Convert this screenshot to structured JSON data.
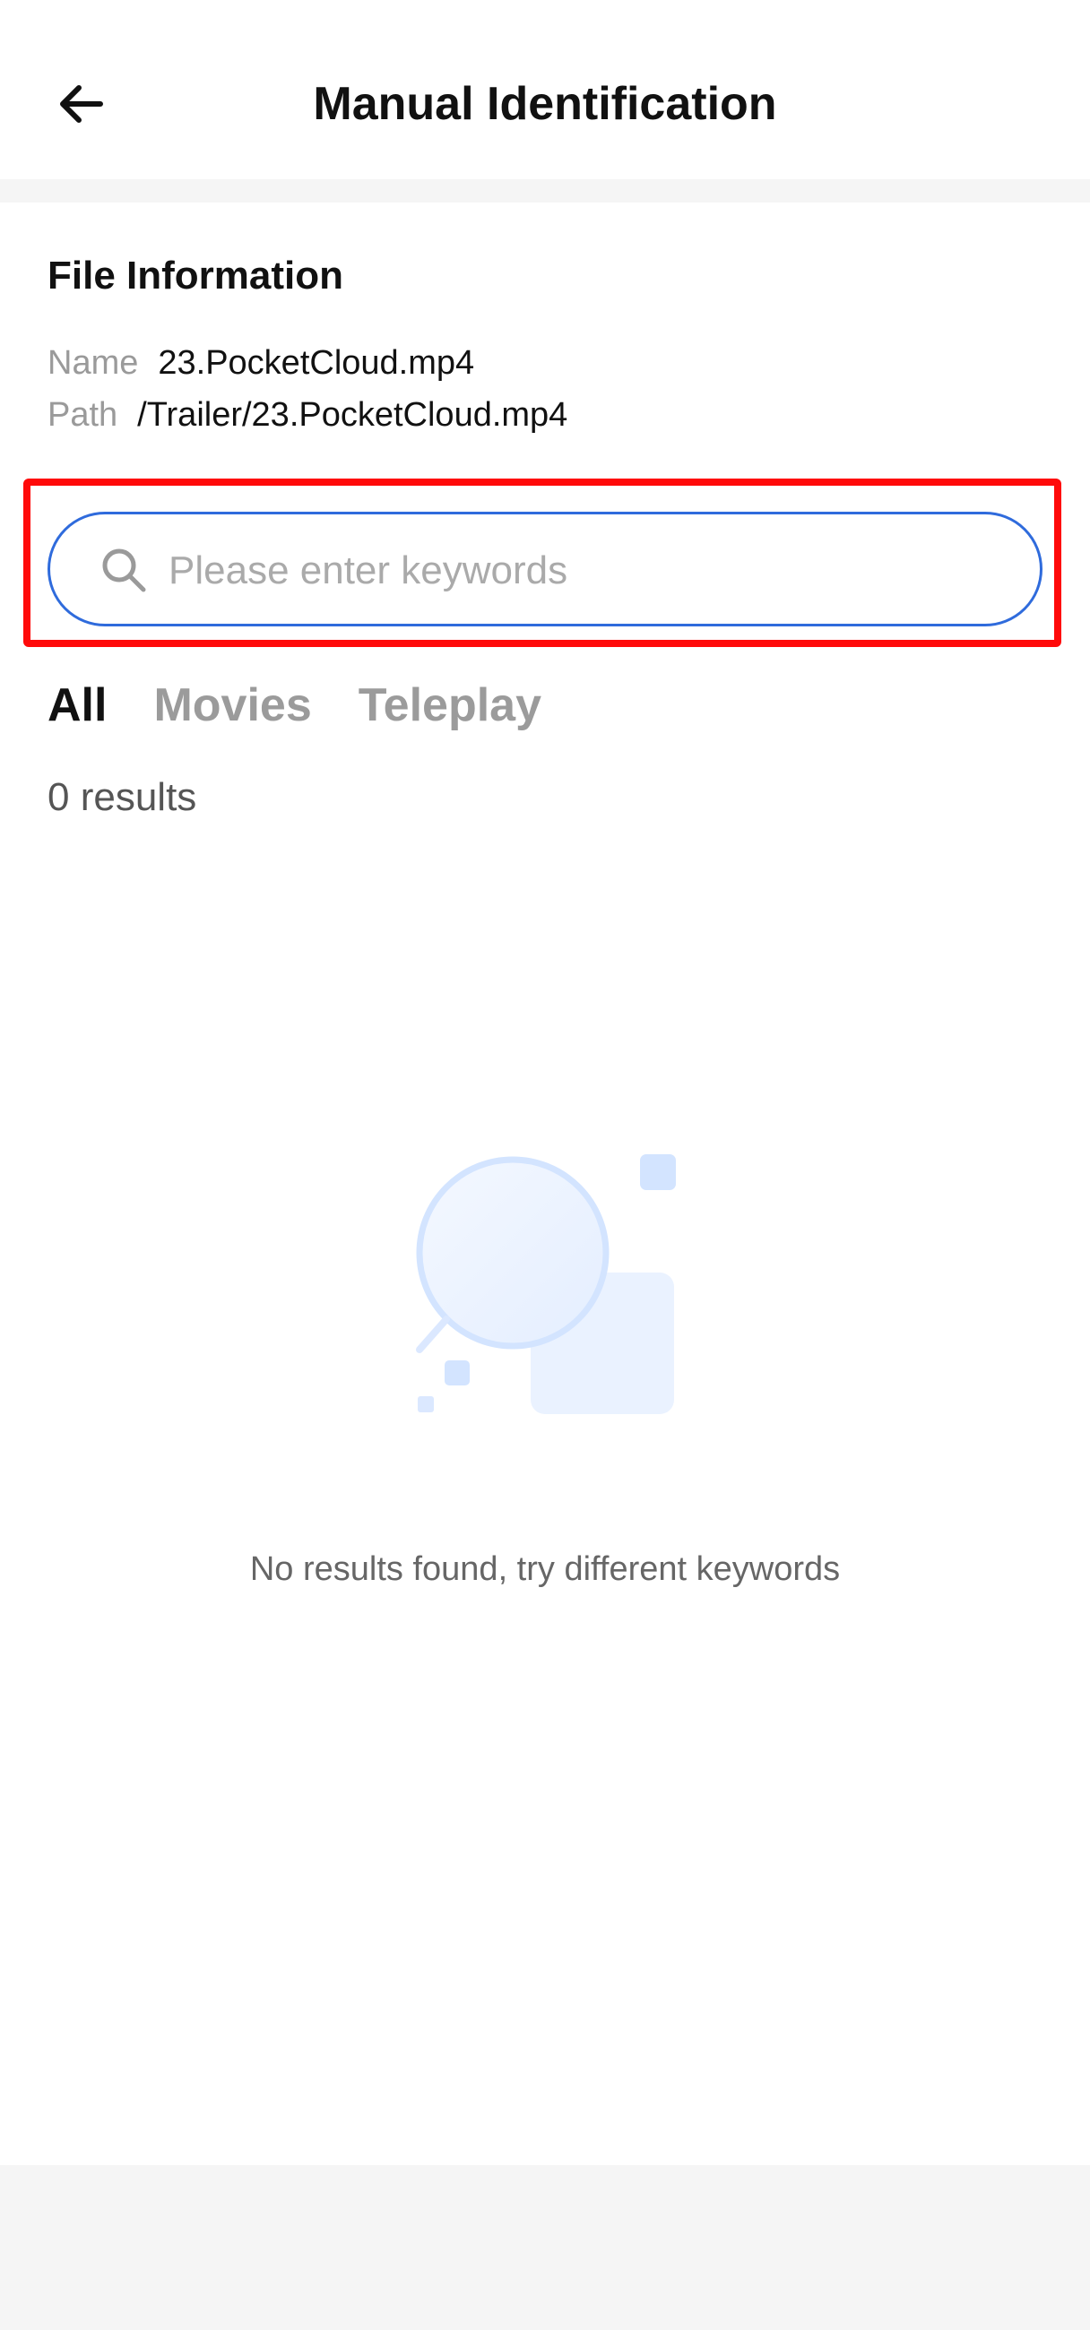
{
  "header": {
    "title": "Manual Identification",
    "back_icon": "arrow-left-icon"
  },
  "file_info": {
    "section_title": "File Information",
    "name_label": "Name",
    "name_value": "23.PocketCloud.mp4",
    "path_label": "Path",
    "path_value": "/Trailer/23.PocketCloud.mp4"
  },
  "search": {
    "icon": "search-icon",
    "value": "",
    "placeholder": "Please enter keywords"
  },
  "tabs": [
    {
      "label": "All",
      "active": true
    },
    {
      "label": "Movies",
      "active": false
    },
    {
      "label": "Teleplay",
      "active": false
    }
  ],
  "results": {
    "count_text": "0 results"
  },
  "empty_state": {
    "icon": "empty-search-illustration-icon",
    "message": "No results found, try different keywords"
  },
  "colors": {
    "accent": "#2f6bdc",
    "highlight": "#ff0a0a",
    "illustration": "#d6e6ff"
  }
}
